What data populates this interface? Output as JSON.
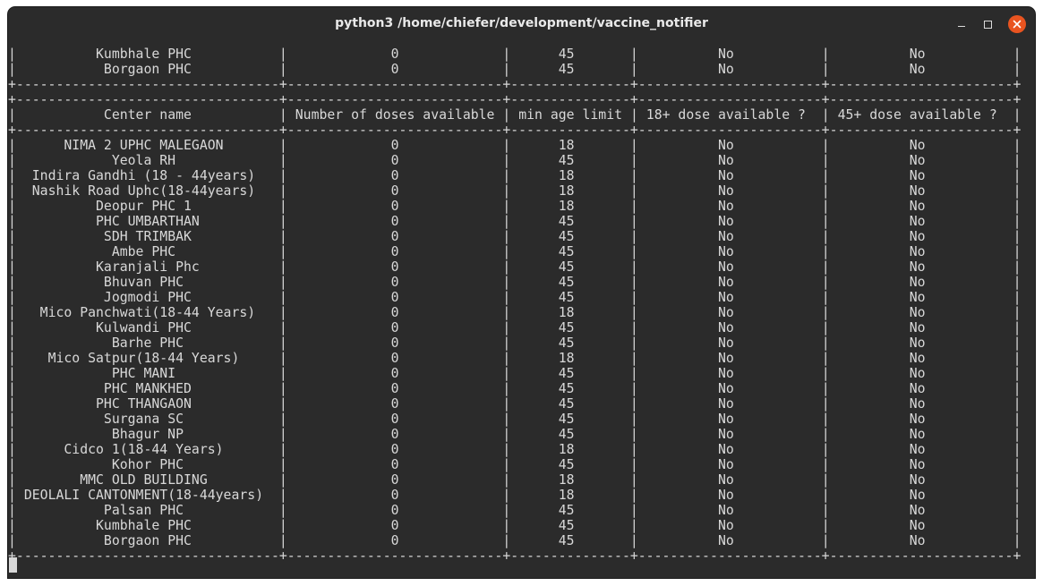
{
  "window": {
    "title": "python3 /home/chiefer/development/vaccine_notifier"
  },
  "header_columns": [
    "Center name",
    "Number of doses available",
    "min age limit",
    "18+ dose available ?",
    "45+ dose available ?"
  ],
  "top_rows": [
    [
      "Kumbhale PHC",
      "0",
      "45",
      "No",
      "No"
    ],
    [
      "Borgaon PHC",
      "0",
      "45",
      "No",
      "No"
    ]
  ],
  "rows": [
    [
      "NIMA 2 UPHC MALEGAON",
      "0",
      "18",
      "No",
      "No"
    ],
    [
      "Yeola RH",
      "0",
      "45",
      "No",
      "No"
    ],
    [
      "Indira Gandhi (18 - 44years)",
      "0",
      "18",
      "No",
      "No"
    ],
    [
      "Nashik Road Uphc(18-44years)",
      "0",
      "18",
      "No",
      "No"
    ],
    [
      "Deopur PHC 1",
      "0",
      "18",
      "No",
      "No"
    ],
    [
      "PHC UMBARTHAN",
      "0",
      "45",
      "No",
      "No"
    ],
    [
      "SDH TRIMBAK",
      "0",
      "45",
      "No",
      "No"
    ],
    [
      "Ambe PHC",
      "0",
      "45",
      "No",
      "No"
    ],
    [
      "Karanjali Phc",
      "0",
      "45",
      "No",
      "No"
    ],
    [
      "Bhuvan PHC",
      "0",
      "45",
      "No",
      "No"
    ],
    [
      "Jogmodi PHC",
      "0",
      "45",
      "No",
      "No"
    ],
    [
      "Mico Panchwati(18-44 Years)",
      "0",
      "18",
      "No",
      "No"
    ],
    [
      "Kulwandi PHC",
      "0",
      "45",
      "No",
      "No"
    ],
    [
      "Barhe PHC",
      "0",
      "45",
      "No",
      "No"
    ],
    [
      "Mico Satpur(18-44 Years)",
      "0",
      "18",
      "No",
      "No"
    ],
    [
      "PHC MANI",
      "0",
      "45",
      "No",
      "No"
    ],
    [
      "PHC MANKHED",
      "0",
      "45",
      "No",
      "No"
    ],
    [
      "PHC THANGAON",
      "0",
      "45",
      "No",
      "No"
    ],
    [
      "Surgana SC",
      "0",
      "45",
      "No",
      "No"
    ],
    [
      "Bhagur NP",
      "0",
      "45",
      "No",
      "No"
    ],
    [
      "Cidco 1(18-44 Years)",
      "0",
      "18",
      "No",
      "No"
    ],
    [
      "Kohor PHC",
      "0",
      "45",
      "No",
      "No"
    ],
    [
      "MMC OLD BUILDING",
      "0",
      "18",
      "No",
      "No"
    ],
    [
      "DEOLALI CANTONMENT(18-44years)",
      "0",
      "18",
      "No",
      "No"
    ],
    [
      "Palsan PHC",
      "0",
      "45",
      "No",
      "No"
    ],
    [
      "Kumbhale PHC",
      "0",
      "45",
      "No",
      "No"
    ],
    [
      "Borgaon PHC",
      "0",
      "45",
      "No",
      "No"
    ]
  ],
  "icons": {
    "minimize": "minimize-icon",
    "maximize": "maximize-icon",
    "close": "close-icon"
  },
  "colors": {
    "terminal_bg": "#2b2b2b",
    "terminal_fg": "#d8d8d8",
    "close_button": "#e95420"
  }
}
